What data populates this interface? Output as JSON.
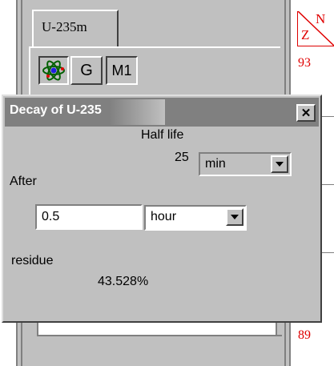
{
  "background": {
    "tab_label": "U-235m",
    "toolbar": {
      "g_label": "G",
      "m1_label": "M1"
    },
    "periodic_strip": {
      "z_label": "Z",
      "n_label": "N",
      "top_number": "93",
      "bottom_number": "89"
    }
  },
  "dialog": {
    "title": "Decay of U-235",
    "close_label": "✕",
    "half_life_label": "Half life",
    "half_life_value": "25",
    "half_life_unit": "min",
    "after_label": "After",
    "after_value": "0.5",
    "after_unit": "hour",
    "residue_label": "residue",
    "residue_value": "43.528%"
  },
  "colors": {
    "accent_red": "#e00000",
    "titlebar_gray": "#808080",
    "face_gray": "#c0c0c0"
  }
}
